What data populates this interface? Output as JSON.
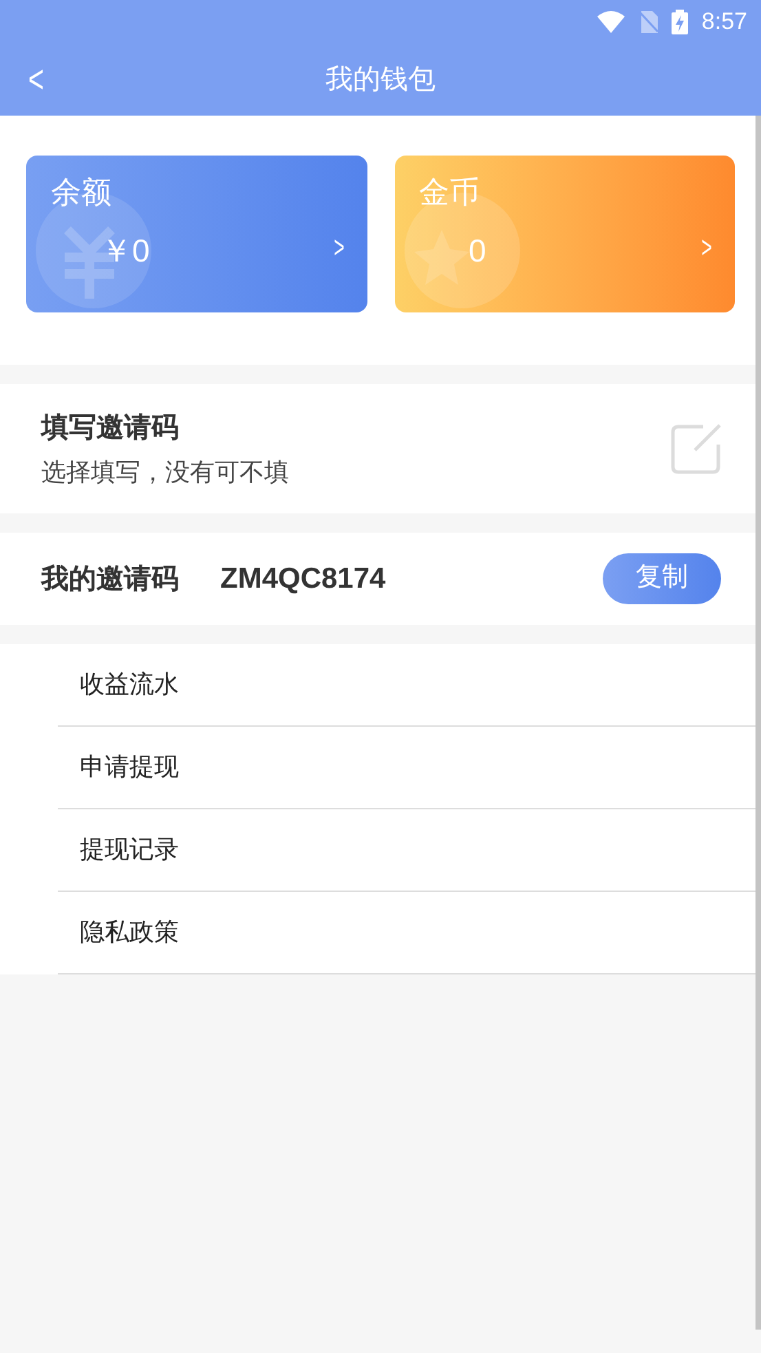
{
  "status_bar": {
    "time": "8:57"
  },
  "header": {
    "back": "<",
    "title": "我的钱包"
  },
  "cards": [
    {
      "kind": "balance",
      "label": "余额",
      "value": "￥0",
      "arrow": ">"
    },
    {
      "kind": "coins",
      "label": "金币",
      "value": "0",
      "arrow": ">"
    }
  ],
  "invite_input": {
    "title": "填写邀请码",
    "subtitle": "选择填写，没有可不填"
  },
  "my_invite": {
    "label": "我的邀请码",
    "code": "ZM4QC8174",
    "copy_button": "复制"
  },
  "menu": [
    {
      "label": "收益流水"
    },
    {
      "label": "申请提现"
    },
    {
      "label": "提现记录"
    },
    {
      "label": "隐私政策"
    }
  ]
}
